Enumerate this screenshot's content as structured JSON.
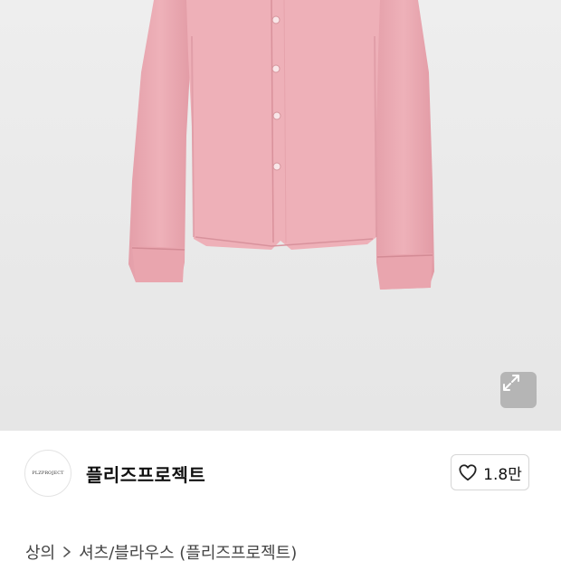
{
  "product": {
    "image_alt": "pink long-sleeve button shirt",
    "shirt_color": "#eba8b1",
    "background_color": "#ececec"
  },
  "icons": {
    "expand": "expand-arrows-icon",
    "heart": "heart-icon",
    "chevron": "chevron-right-icon"
  },
  "seller": {
    "logo_text": "PLZPROJECT",
    "name": "플리즈프로젝트"
  },
  "like": {
    "count": "1.8만"
  },
  "breadcrumb": {
    "category": "상의",
    "subcategory": "셔츠/블라우스 (플리즈프로젝트)"
  }
}
